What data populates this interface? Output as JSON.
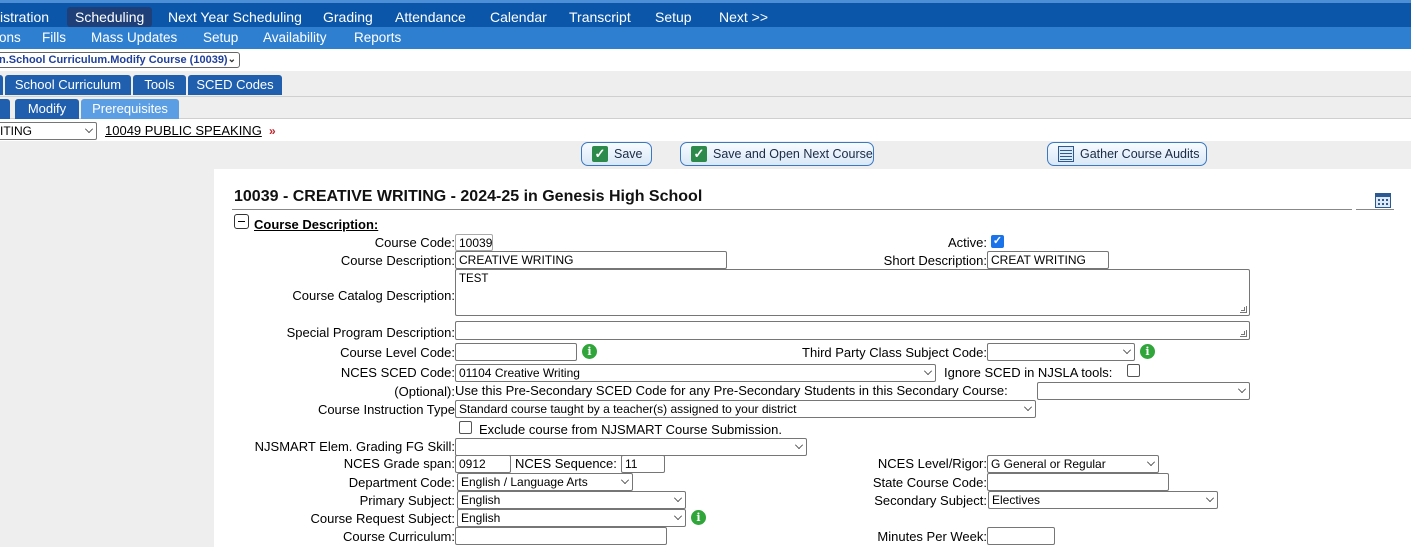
{
  "nav_primary": [
    "istration",
    "Scheduling",
    "Next Year Scheduling",
    "Grading",
    "Attendance",
    "Calendar",
    "Transcript",
    "Setup",
    "Next >>"
  ],
  "nav_secondary": [
    "ons",
    "Fills",
    "Mass Updates",
    "Setup",
    "Availability",
    "Reports"
  ],
  "breadcrumb_select": "n.School Curriculum.Modify Course (10039)",
  "tabs_row1": [
    "School Curriculum",
    "Tools",
    "SCED Codes"
  ],
  "tabs_row2": [
    "Modify",
    "Prerequisites"
  ],
  "course_select": "ITING",
  "next_course_link": "10049 PUBLIC SPEAKING",
  "next_arrow": "»",
  "buttons": {
    "save": "Save",
    "save_next": "Save and Open Next Course",
    "gather": "Gather Course Audits"
  },
  "page_title": "10039 - CREATIVE WRITING - 2024-25 in Genesis High School",
  "section_header": "Course Description:",
  "labels": {
    "course_code": "Course Code:",
    "active": "Active:",
    "course_description": "Course Description:",
    "short_description": "Short Description:",
    "catalog_description": "Course Catalog Description:",
    "special_program": "Special Program Description:",
    "course_level": "Course Level Code:",
    "third_party": "Third Party Class Subject Code:",
    "nces_sced": "NCES SCED Code:",
    "ignore_sced": "Ignore SCED in NJSLA tools:",
    "optional": "(Optional):",
    "optional_text": "Use this Pre-Secondary SCED Code for any Pre-Secondary Students in this Secondary Course:",
    "instruction_type": "Course Instruction Type",
    "exclude_njsmart": "Exclude course from NJSMART Course Submission.",
    "njsmart_skill": "NJSMART Elem. Grading FG Skill:",
    "grade_span": "NCES Grade span:",
    "nces_sequence": "NCES Sequence:",
    "nces_level": "NCES Level/Rigor:",
    "department": "Department Code:",
    "state_course": "State Course Code:",
    "primary_subject": "Primary Subject:",
    "secondary_subject": "Secondary Subject:",
    "request_subject": "Course Request Subject:",
    "curriculum": "Course Curriculum:",
    "minutes_per_week": "Minutes Per Week:"
  },
  "values": {
    "course_code": "10039",
    "active": true,
    "course_description": "CREATIVE WRITING",
    "short_description": "CREAT WRITING",
    "catalog_description": "TEST",
    "special_program": "",
    "course_level": "",
    "third_party": "",
    "nces_sced": "01104 Creative Writing",
    "ignore_sced": false,
    "optional_sced": "",
    "instruction_type": "Standard course taught by a teacher(s) assigned to your district",
    "exclude_njsmart": false,
    "njsmart_skill": "",
    "grade_span": "0912",
    "nces_sequence": "11",
    "nces_level": "G General or Regular",
    "department": "English / Language Arts",
    "state_course": "",
    "primary_subject": "English",
    "secondary_subject": "Electives",
    "request_subject": "English",
    "curriculum": "",
    "minutes_per_week": ""
  },
  "colors": {
    "nav_primary": "#0b56a8",
    "nav_secondary": "#2f7fd0",
    "tab_dark": "#1f5fae",
    "tab_light": "#5b9ee4",
    "info": "#2fa53a"
  }
}
